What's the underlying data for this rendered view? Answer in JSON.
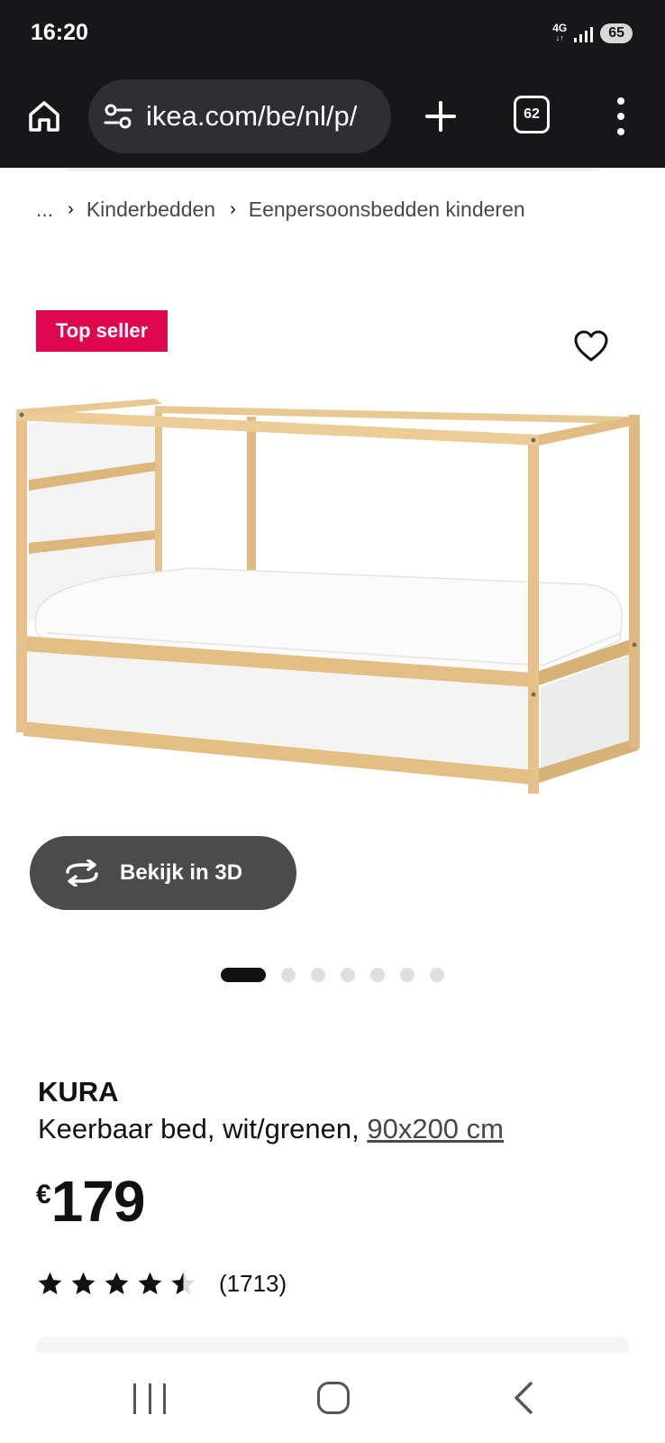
{
  "status_bar": {
    "time": "16:20",
    "network": "4G",
    "battery": "65"
  },
  "browser": {
    "url": "ikea.com/be/nl/p/",
    "tab_count": "62",
    "icons": {
      "home": "home-icon",
      "site_settings": "tune-icon",
      "new_tab": "plus-icon",
      "tabs": "tab-switcher-icon",
      "menu": "more-vert-icon"
    }
  },
  "breadcrumb": {
    "items": [
      "...",
      "Kinderbedden",
      "Eenpersoonsbedden kinderen"
    ]
  },
  "product": {
    "badge": "Top seller",
    "badge_color": "#e00751",
    "view_3d_label": "Bekijk in 3D",
    "image_count": 7,
    "active_image": 1,
    "name": "KURA",
    "description": "Keerbaar bed, wit/grenen, ",
    "size": "90x200 cm",
    "currency": "€",
    "price": "179",
    "rating": 4.5,
    "rating_count": "(1713)"
  },
  "nav_bar": {
    "icons": [
      "recents-icon",
      "home-icon",
      "back-icon"
    ]
  }
}
